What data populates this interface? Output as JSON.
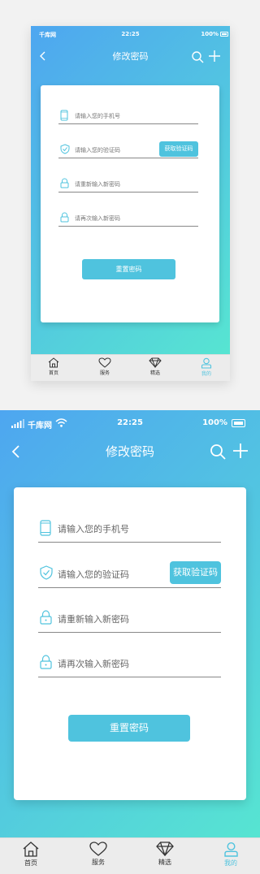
{
  "status": {
    "carrier": "千库网",
    "time": "22:25",
    "battery": "100%"
  },
  "nav": {
    "title": "修改密码"
  },
  "form": {
    "phone_placeholder": "请输入您的手机号",
    "code_placeholder": "请输入您的验证码",
    "get_code_label": "获取验证码",
    "new_password_placeholder": "请重新输入新密码",
    "confirm_password_placeholder": "请再次输入新密码",
    "reset_label": "重置密码"
  },
  "tabs": [
    {
      "label": "首页",
      "icon": "home-icon",
      "active": false
    },
    {
      "label": "服务",
      "icon": "heart-icon",
      "active": false
    },
    {
      "label": "精选",
      "icon": "diamond-icon",
      "active": false
    },
    {
      "label": "我的",
      "icon": "user-icon",
      "active": true
    }
  ],
  "colors": {
    "gradient_start": "#4ea6f0",
    "gradient_end": "#57e8d0",
    "accent": "#4fc3de"
  }
}
